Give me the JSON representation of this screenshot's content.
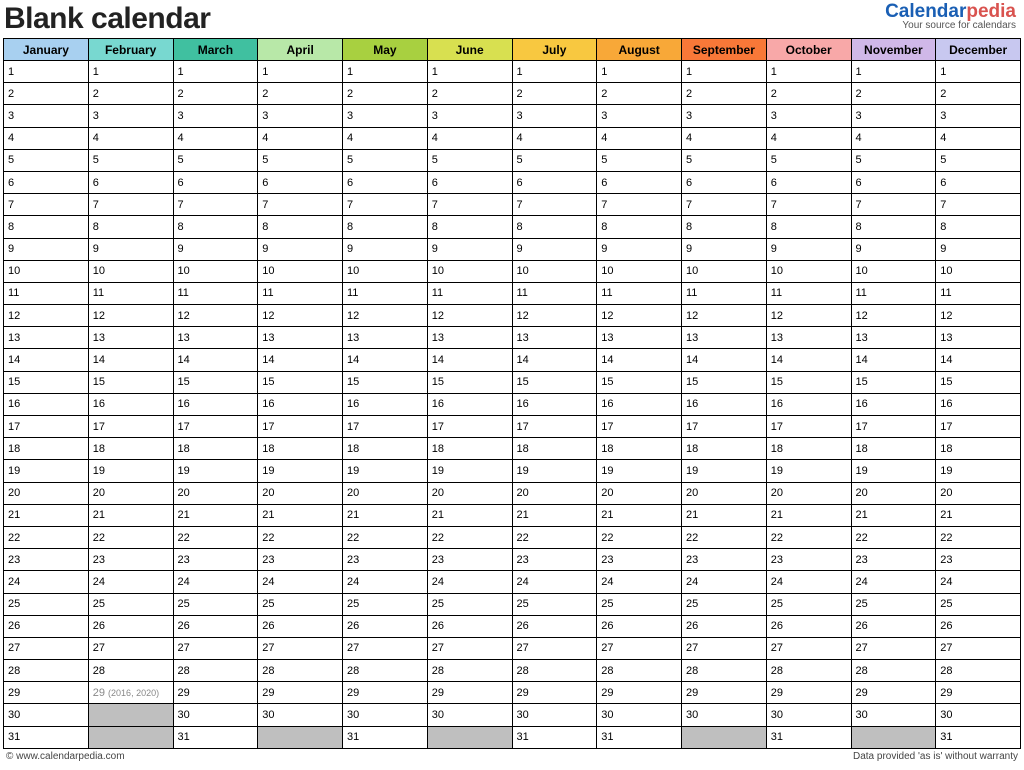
{
  "title": "Blank calendar",
  "brand": {
    "part1": "Calendar",
    "part2": "pedia",
    "tagline": "Your source for calendars"
  },
  "months": [
    {
      "name": "January",
      "days": 31,
      "color": "#a8d0f0"
    },
    {
      "name": "February",
      "days": 28,
      "color": "#78d8d0",
      "leap": {
        "day": 29,
        "note": "(2016, 2020)"
      }
    },
    {
      "name": "March",
      "days": 31,
      "color": "#40c0a0"
    },
    {
      "name": "April",
      "days": 30,
      "color": "#b8e8a8"
    },
    {
      "name": "May",
      "days": 31,
      "color": "#a8d040"
    },
    {
      "name": "June",
      "days": 30,
      "color": "#d8e050"
    },
    {
      "name": "July",
      "days": 31,
      "color": "#f8c840"
    },
    {
      "name": "August",
      "days": 31,
      "color": "#f8a838"
    },
    {
      "name": "September",
      "days": 30,
      "color": "#f87838"
    },
    {
      "name": "October",
      "days": 31,
      "color": "#f8a8a8"
    },
    {
      "name": "November",
      "days": 30,
      "color": "#d0b8e8"
    },
    {
      "name": "December",
      "days": 31,
      "color": "#c8c8f0"
    }
  ],
  "max_days": 31,
  "footer": {
    "left": "© www.calendarpedia.com",
    "right": "Data provided 'as is' without warranty"
  }
}
